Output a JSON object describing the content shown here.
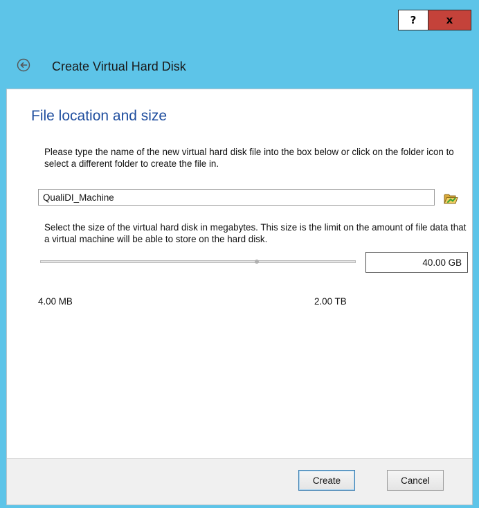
{
  "titlebar": {
    "help_label": "?",
    "close_label": "x"
  },
  "header": {
    "title": "Create Virtual Hard Disk"
  },
  "section": {
    "title": "File location and size",
    "location_description": "Please type the name of the new virtual hard disk file into the box below or click on the folder icon to select a different folder to create the file in.",
    "file_name": "QualiDI_Machine",
    "size_description": "Select the size of the virtual hard disk in megabytes. This size is the limit on the amount of file data that a virtual machine will be able to store on the hard disk.",
    "size_value": "40.00 GB",
    "min_label": "4.00 MB",
    "max_label": "2.00 TB"
  },
  "footer": {
    "create_label": "Create",
    "cancel_label": "Cancel"
  },
  "icons": {
    "back": "back-arrow-icon",
    "folder": "folder-open-icon"
  },
  "colors": {
    "titlebar": "#5dc4e8",
    "close": "#c4423a",
    "section_title": "#1e4d9e"
  }
}
